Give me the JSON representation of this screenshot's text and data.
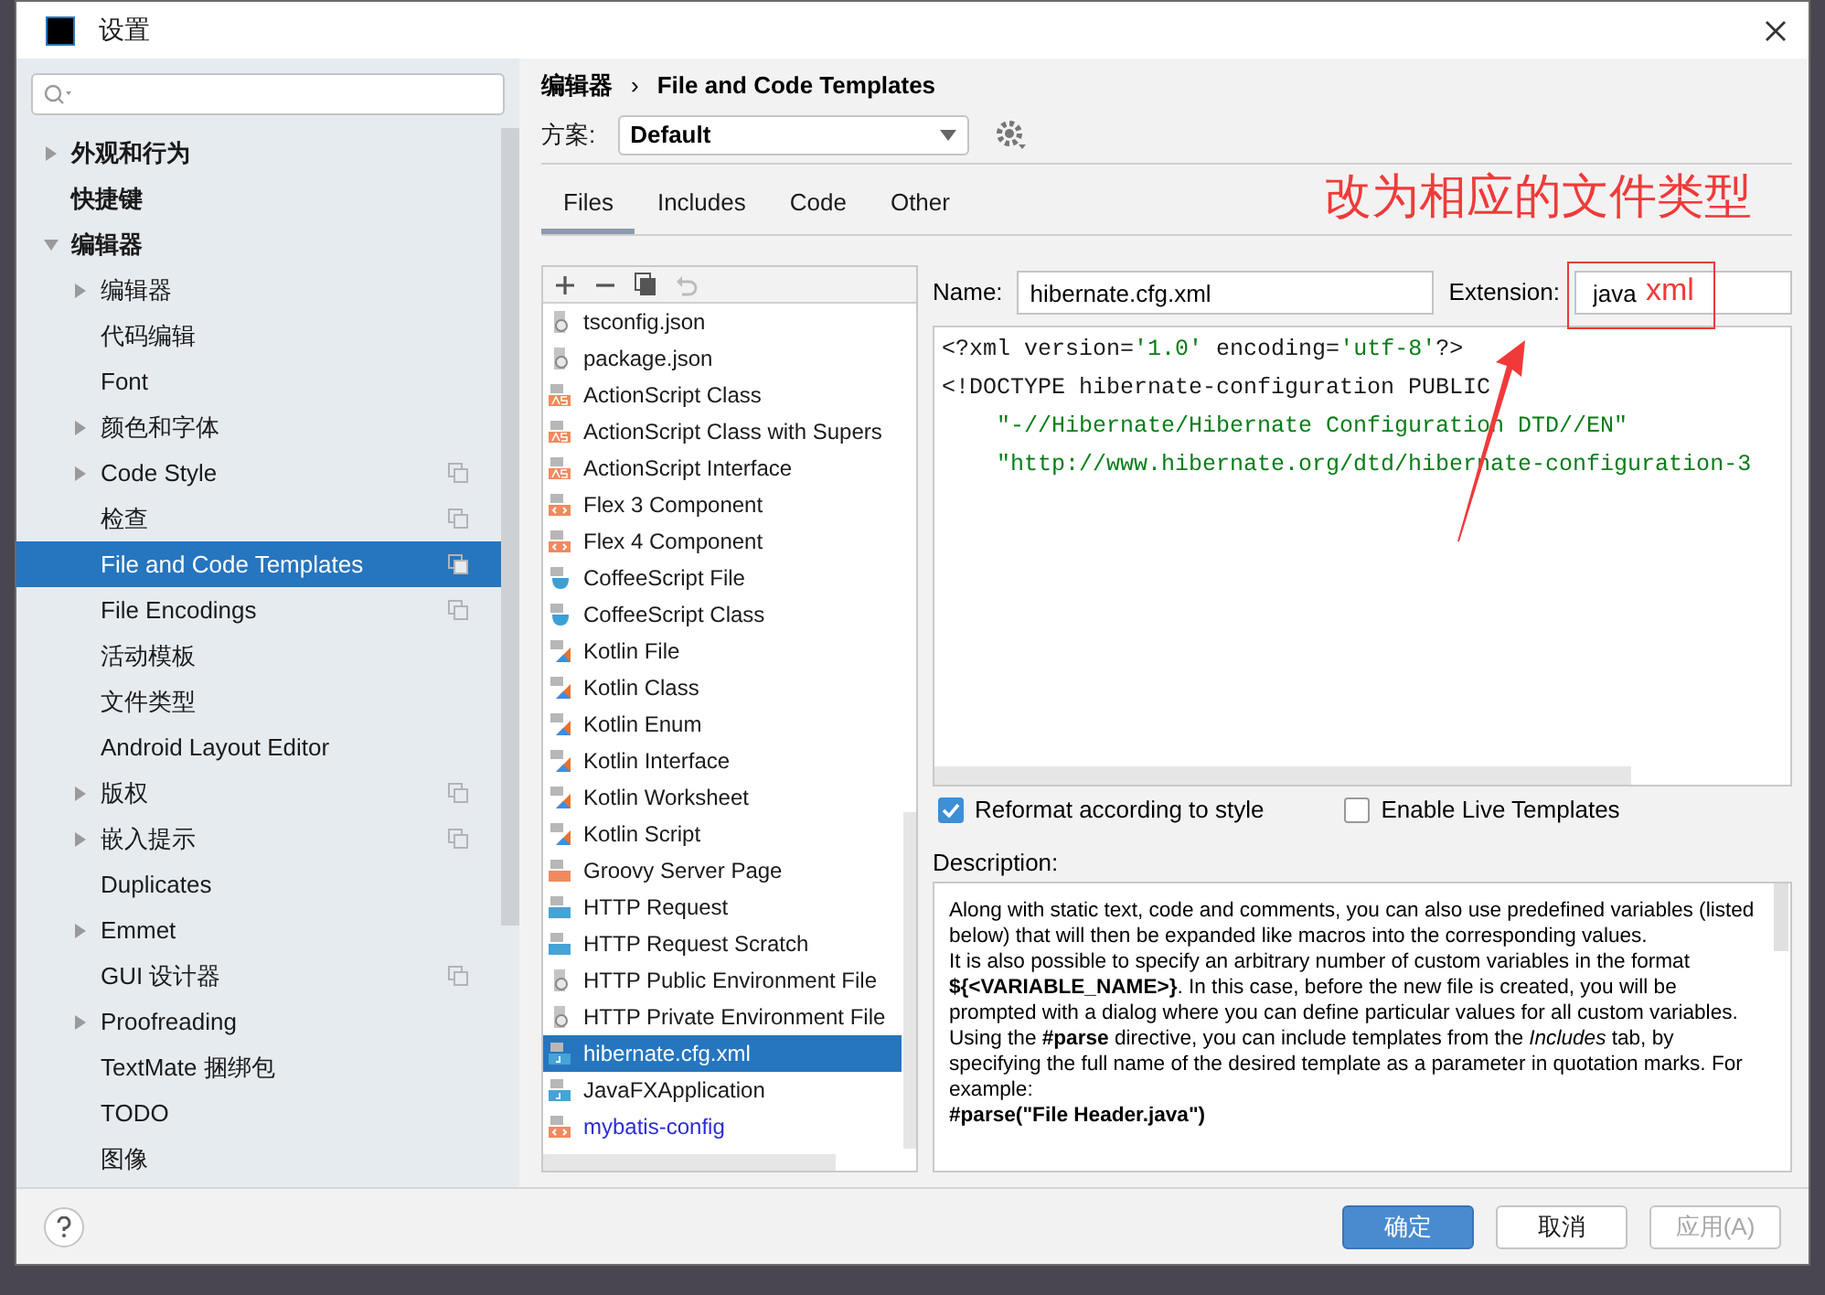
{
  "window": {
    "title": "设置"
  },
  "sidebar": {
    "items": [
      {
        "label": "外观和行为",
        "expanded": false,
        "project_level": false,
        "selected": false
      },
      {
        "label": "快捷键",
        "project_level": false,
        "selected": false
      },
      {
        "label": "编辑器",
        "expanded": true,
        "project_level": false,
        "selected": false,
        "children": [
          {
            "label": "编辑器",
            "expanded": false,
            "project_level": false,
            "selected": false
          },
          {
            "label": "代码编辑",
            "project_level": false,
            "selected": false
          },
          {
            "label": "Font",
            "project_level": false,
            "selected": false
          },
          {
            "label": "颜色和字体",
            "expanded": false,
            "project_level": false,
            "selected": false
          },
          {
            "label": "Code Style",
            "expanded": false,
            "project_level": true,
            "selected": false
          },
          {
            "label": "检查",
            "project_level": true,
            "selected": false
          },
          {
            "label": "File and Code Templates",
            "project_level": true,
            "selected": true
          },
          {
            "label": "File Encodings",
            "project_level": true,
            "selected": false
          },
          {
            "label": "活动模板",
            "project_level": false,
            "selected": false
          },
          {
            "label": "文件类型",
            "project_level": false,
            "selected": false
          },
          {
            "label": "Android Layout Editor",
            "project_level": false,
            "selected": false
          },
          {
            "label": "版权",
            "expanded": false,
            "project_level": true,
            "selected": false
          },
          {
            "label": "嵌入提示",
            "expanded": false,
            "project_level": true,
            "selected": false
          },
          {
            "label": "Duplicates",
            "project_level": false,
            "selected": false
          },
          {
            "label": "Emmet",
            "expanded": false,
            "project_level": false,
            "selected": false
          },
          {
            "label": "GUI 设计器",
            "project_level": true,
            "selected": false
          },
          {
            "label": "Proofreading",
            "expanded": false,
            "project_level": false,
            "selected": false
          },
          {
            "label": "TextMate 捆绑包",
            "project_level": false,
            "selected": false
          },
          {
            "label": "TODO",
            "project_level": false,
            "selected": false
          },
          {
            "label": "图像",
            "project_level": false,
            "selected": false
          }
        ]
      }
    ]
  },
  "breadcrumb": [
    "编辑器",
    "›",
    "File and Code Templates"
  ],
  "scheme": {
    "label": "方案:",
    "value": "Default"
  },
  "tabs": [
    {
      "label": "Files",
      "selected": true
    },
    {
      "label": "Includes",
      "selected": false
    },
    {
      "label": "Code",
      "selected": false
    },
    {
      "label": "Other",
      "selected": false
    }
  ],
  "templates": [
    {
      "label": "tsconfig.json",
      "kind": "json",
      "selected": false,
      "customized": false
    },
    {
      "label": "package.json",
      "kind": "json",
      "selected": false,
      "customized": false
    },
    {
      "label": "ActionScript Class",
      "kind": "as",
      "selected": false,
      "customized": false
    },
    {
      "label": "ActionScript Class with Supers",
      "kind": "as",
      "selected": false,
      "customized": false
    },
    {
      "label": "ActionScript Interface",
      "kind": "as",
      "selected": false,
      "customized": false
    },
    {
      "label": "Flex 3 Component",
      "kind": "flex",
      "selected": false,
      "customized": false
    },
    {
      "label": "Flex 4 Component",
      "kind": "flex",
      "selected": false,
      "customized": false
    },
    {
      "label": "CoffeeScript File",
      "kind": "coffee",
      "selected": false,
      "customized": false
    },
    {
      "label": "CoffeeScript Class",
      "kind": "coffee",
      "selected": false,
      "customized": false
    },
    {
      "label": "Kotlin File",
      "kind": "kotlin",
      "selected": false,
      "customized": false
    },
    {
      "label": "Kotlin Class",
      "kind": "kotlin",
      "selected": false,
      "customized": false
    },
    {
      "label": "Kotlin Enum",
      "kind": "kotlin",
      "selected": false,
      "customized": false
    },
    {
      "label": "Kotlin Interface",
      "kind": "kotlin",
      "selected": false,
      "customized": false
    },
    {
      "label": "Kotlin Worksheet",
      "kind": "kotlin",
      "selected": false,
      "customized": false
    },
    {
      "label": "Kotlin Script",
      "kind": "kotlin",
      "selected": false,
      "customized": false
    },
    {
      "label": "Groovy Server Page",
      "kind": "gsp",
      "selected": false,
      "customized": false
    },
    {
      "label": "HTTP Request",
      "kind": "api",
      "selected": false,
      "customized": false
    },
    {
      "label": "HTTP Request Scratch",
      "kind": "api",
      "selected": false,
      "customized": false
    },
    {
      "label": "HTTP Public Environment File",
      "kind": "json",
      "selected": false,
      "customized": false
    },
    {
      "label": "HTTP Private Environment File",
      "kind": "json",
      "selected": false,
      "customized": false
    },
    {
      "label": "hibernate.cfg.xml",
      "kind": "java",
      "selected": true,
      "customized": false
    },
    {
      "label": "JavaFXApplication",
      "kind": "java",
      "selected": false,
      "customized": false
    },
    {
      "label": "mybatis-config",
      "kind": "flex",
      "selected": false,
      "customized": true
    }
  ],
  "name_field": {
    "label": "Name:",
    "value": "hibernate.cfg.xml"
  },
  "extension_field": {
    "label": "Extension:",
    "value": "java"
  },
  "code": [
    {
      "indented": false,
      "segments": [
        {
          "text": "<?xml version=",
          "kind": "tag"
        },
        {
          "text": "'1.0'",
          "kind": "string"
        },
        {
          "text": " encoding=",
          "kind": "tag"
        },
        {
          "text": "'utf-8'",
          "kind": "string"
        },
        {
          "text": "?>",
          "kind": "tag"
        }
      ]
    },
    {
      "indented": false,
      "segments": [
        {
          "text": "<!DOCTYPE hibernate-configuration PUBLIC",
          "kind": "tag"
        }
      ]
    },
    {
      "indented": true,
      "segments": [
        {
          "text": "\"-//Hibernate/Hibernate Configuration DTD//EN\"",
          "kind": "string"
        }
      ]
    },
    {
      "indented": true,
      "segments": [
        {
          "text": "\"http://www.hibernate.org/dtd/hibernate-configuration-3",
          "kind": "string"
        }
      ]
    }
  ],
  "options": [
    {
      "label": "Reformat according to style",
      "checked": true
    },
    {
      "label": "Enable Live Templates",
      "checked": false
    }
  ],
  "description": {
    "label": "Description:",
    "paragraphs": [
      "Along with static text, code and comments, you can also use predefined variables (listed below) that will then be expanded like macros into the corresponding values.",
      "It is also possible to specify an arbitrary number of custom variables in the format **${<VARIABLE_NAME>}**. In this case, before the new file is created, you will be prompted with a dialog where you can define particular values for all custom variables.",
      "Using the **#parse** directive, you can include templates from the *Includes* tab, by specifying the full name of the desired template as a parameter in quotation marks. For example:",
      "**#parse(\"File Header.java\")**"
    ]
  },
  "buttons": [
    {
      "label": "确定",
      "primary": true,
      "disabled": false
    },
    {
      "label": "取消",
      "primary": false,
      "disabled": false
    },
    {
      "label": "应用(A)",
      "primary": false,
      "disabled": true
    }
  ],
  "annotation": {
    "heading": "改为相应的文件类型",
    "boxed_text": "xml"
  }
}
